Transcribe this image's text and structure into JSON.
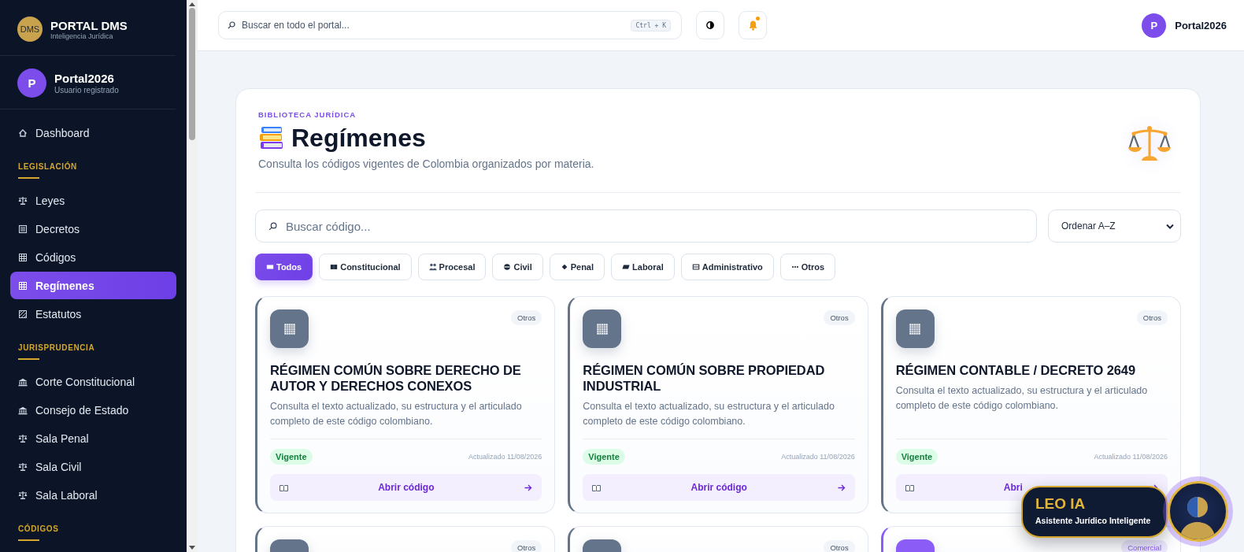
{
  "brand": {
    "logo": "DMS",
    "name": "PORTAL DMS",
    "tagline": "Inteligencia Jurídica"
  },
  "user": {
    "initial": "P",
    "name": "Portal2026",
    "role": "Usuario registrado"
  },
  "sidebar": {
    "items": [
      {
        "kind": "link",
        "label": "Dashboard",
        "selected": false
      },
      {
        "kind": "heading",
        "label": "LEGISLACIÓN"
      },
      {
        "kind": "link",
        "label": "Leyes",
        "selected": false
      },
      {
        "kind": "link",
        "label": "Decretos",
        "selected": false
      },
      {
        "kind": "link",
        "label": "Códigos",
        "selected": false
      },
      {
        "kind": "link",
        "label": "Regímenes",
        "selected": true
      },
      {
        "kind": "link",
        "label": "Estatutos",
        "selected": false
      },
      {
        "kind": "heading",
        "label": "JURISPRUDENCIA"
      },
      {
        "kind": "link",
        "label": "Corte Constitucional",
        "selected": false
      },
      {
        "kind": "link",
        "label": "Consejo de Estado",
        "selected": false
      },
      {
        "kind": "link",
        "label": "Sala Penal",
        "selected": false
      },
      {
        "kind": "link",
        "label": "Sala Civil",
        "selected": false
      },
      {
        "kind": "link",
        "label": "Sala Laboral",
        "selected": false
      },
      {
        "kind": "heading",
        "label": "CÓDIGOS"
      }
    ]
  },
  "topbar": {
    "search": {
      "placeholder": "Buscar en todo el portal...",
      "shortcut": "Ctrl + K"
    },
    "notifications": {
      "unread": true
    },
    "user": {
      "initial": "P",
      "name": "Portal2026"
    }
  },
  "header": {
    "eyebrow": "BIBLIOTECA JURÍDICA",
    "title": "Regímenes",
    "subtitle": "Consulta los códigos vigentes de Colombia organizados por materia."
  },
  "filters": {
    "search": {
      "placeholder": "Buscar código..."
    },
    "sort": {
      "value": "Ordenar A–Z"
    },
    "chips": [
      {
        "label": "Todos",
        "selected": true
      },
      {
        "label": "Constitucional",
        "selected": false
      },
      {
        "label": "Procesal",
        "selected": false
      },
      {
        "label": "Civil",
        "selected": false
      },
      {
        "label": "Penal",
        "selected": false
      },
      {
        "label": "Laboral",
        "selected": false
      },
      {
        "label": "Administrativo",
        "selected": false
      },
      {
        "label": "Otros",
        "selected": false
      }
    ]
  },
  "cards": [
    {
      "color": "#64748b",
      "category": "Otros",
      "title": "RÉGIMEN COMÚN SOBRE DERECHO DE AUTOR Y DERECHOS CONEXOS",
      "description": "Consulta el texto actualizado, su estructura y el articulado completo de este código colombiano.",
      "status": "Vigente",
      "updated": "Actualizado 11/08/2026",
      "action": "Abrir código"
    },
    {
      "color": "#64748b",
      "category": "Otros",
      "title": "RÉGIMEN COMÚN SOBRE PROPIEDAD INDUSTRIAL",
      "description": "Consulta el texto actualizado, su estructura y el articulado completo de este código colombiano.",
      "status": "Vigente",
      "updated": "Actualizado 11/08/2026",
      "action": "Abrir código"
    },
    {
      "color": "#64748b",
      "category": "Otros",
      "title": "RÉGIMEN CONTABLE / DECRETO 2649",
      "description": "Consulta el texto actualizado, su estructura y el articulado completo de este código colombiano.",
      "status": "Vigente",
      "updated": "Actualizado 11/08/2026",
      "action": "Abri"
    },
    {
      "color": "#64748b",
      "category": "Otros"
    },
    {
      "color": "#64748b",
      "category": "Otros"
    },
    {
      "color": "#8b5cf6",
      "category": "Comercial"
    }
  ],
  "assistant": {
    "name": "LEO IA",
    "subtitle": "Asistente Jurídico Inteligente"
  }
}
